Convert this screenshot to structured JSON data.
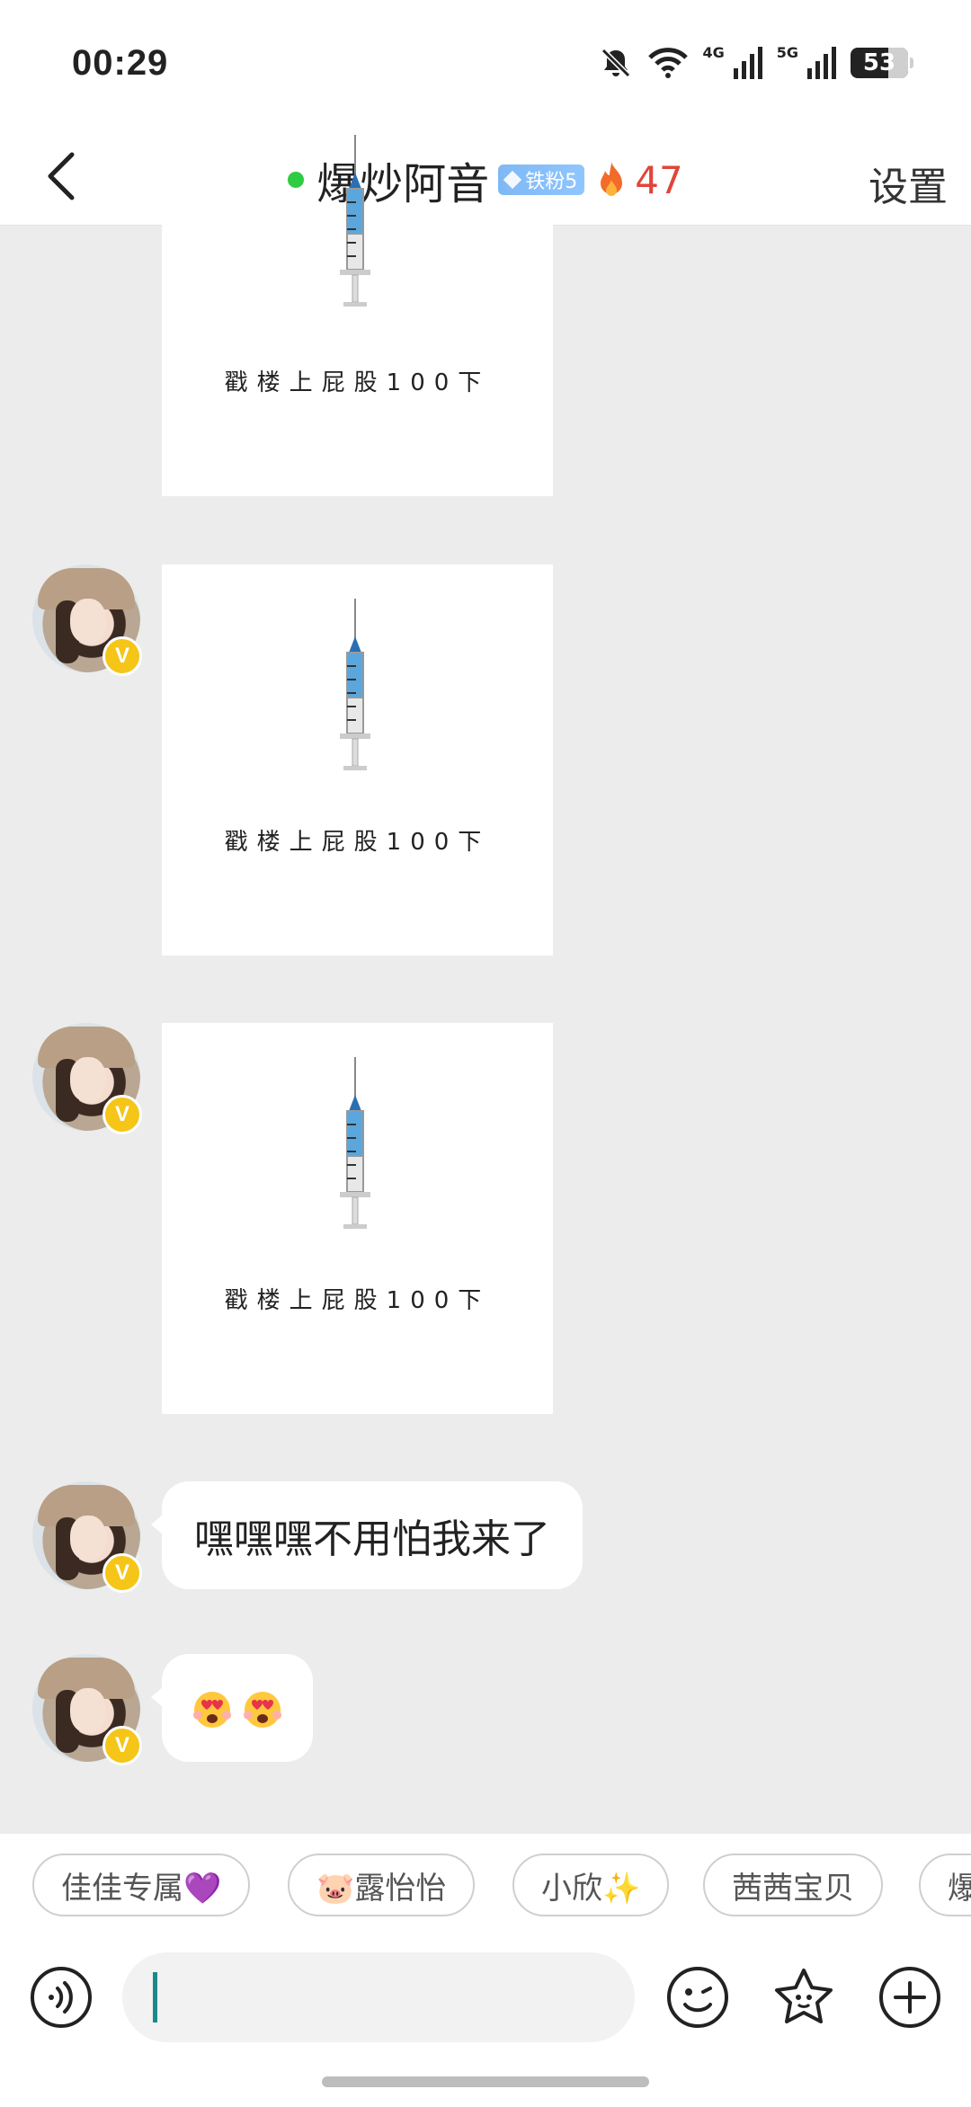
{
  "status_bar": {
    "time": "00:29",
    "net1": "4G",
    "net2": "5G",
    "battery": "53"
  },
  "header": {
    "title": "爆炒阿音",
    "fan_badge": "铁粉5",
    "streak": "47",
    "settings": "设置",
    "colors": {
      "online": "#2ecc40",
      "streak": "#e0453a",
      "badge": "#8fc6ff"
    }
  },
  "messages": [
    {
      "type": "card",
      "caption": "戳楼上屁股100下",
      "icon": "syringe-icon"
    },
    {
      "type": "card",
      "caption": "戳楼上屁股100下",
      "icon": "syringe-icon"
    },
    {
      "type": "card",
      "caption": "戳楼上屁股100下",
      "icon": "syringe-icon"
    },
    {
      "type": "text",
      "text": "嘿嘿嘿不用怕我来了"
    },
    {
      "type": "emoji",
      "icons": [
        "heart-eyes-emoji",
        "heart-eyes-emoji"
      ]
    }
  ],
  "avatar_badge": "V",
  "quick_replies": [
    "佳佳专属💜",
    "🐷露怡怡",
    "小欣✨",
    "茜茜宝贝",
    "爆"
  ],
  "input": {
    "placeholder": ""
  }
}
